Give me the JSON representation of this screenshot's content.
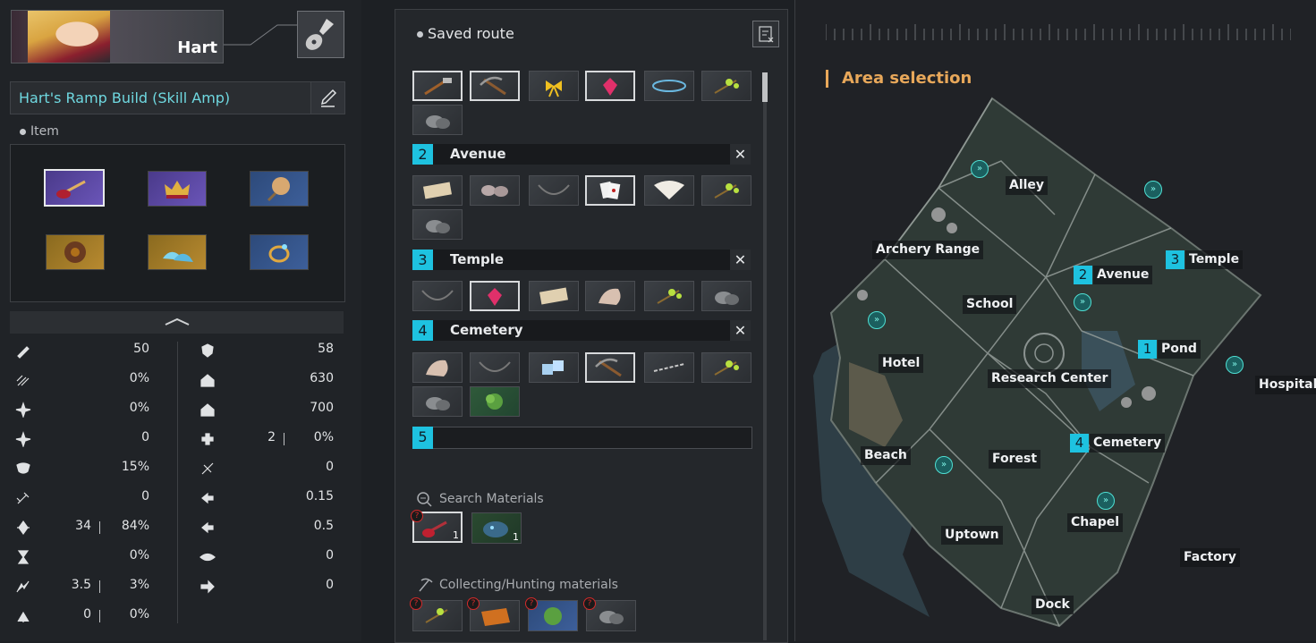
{
  "character": {
    "name": "Hart"
  },
  "build": {
    "name": "Hart's Ramp Build (Skill Amp)"
  },
  "item_section": {
    "label": "Item"
  },
  "stats_left": [
    {
      "icon": "attack-power-icon",
      "a": "",
      "b": "50"
    },
    {
      "icon": "attack-speed-icon",
      "a": "",
      "b": "0%"
    },
    {
      "icon": "critical-chance-icon",
      "a": "",
      "b": "0%"
    },
    {
      "icon": "critical-damage-icon",
      "a": "",
      "b": "0"
    },
    {
      "icon": "life-steal-icon",
      "a": "",
      "b": "15%"
    },
    {
      "icon": "extra-normal-attack-icon",
      "a": "",
      "b": "0"
    },
    {
      "icon": "skill-amp-icon",
      "a": "34",
      "b": "84%"
    },
    {
      "icon": "cooldown-icon",
      "a": "",
      "b": "0%"
    },
    {
      "icon": "sp-regen-icon",
      "a": "3.5",
      "b": "3%"
    },
    {
      "icon": "armor-pen-icon",
      "a": "0",
      "b": "0%"
    }
  ],
  "stats_right": [
    {
      "icon": "defense-icon",
      "a": "",
      "b": "58"
    },
    {
      "icon": "max-hp-icon",
      "a": "",
      "b": "630"
    },
    {
      "icon": "max-sp-icon",
      "a": "",
      "b": "700"
    },
    {
      "icon": "hp-regen-icon",
      "a": "2",
      "b": "0%"
    },
    {
      "icon": "damage-reduction-icon",
      "a": "",
      "b": "0"
    },
    {
      "icon": "movement-speed-icon",
      "a": "",
      "b": "0.15"
    },
    {
      "icon": "out-of-combat-speed-icon",
      "a": "",
      "b": "0.5"
    },
    {
      "icon": "vision-icon",
      "a": "",
      "b": "0"
    },
    {
      "icon": "attack-range-icon",
      "a": "",
      "b": "0"
    }
  ],
  "route": {
    "title": "Saved route",
    "stops": [
      {
        "num": "2",
        "name": "Avenue"
      },
      {
        "num": "3",
        "name": "Temple"
      },
      {
        "num": "4",
        "name": "Cemetery"
      }
    ],
    "empty_num": "5",
    "search_label": "Search Materials",
    "collect_label": "Collecting/Hunting materials",
    "search_counts": [
      "1",
      "1"
    ],
    "badge": "?"
  },
  "map": {
    "title": "Area selection",
    "areas": [
      {
        "name": "Alley"
      },
      {
        "name": "Archery Range"
      },
      {
        "name": "School"
      },
      {
        "name": "Avenue",
        "num": "2"
      },
      {
        "name": "Temple",
        "num": "3"
      },
      {
        "name": "Pond",
        "num": "1"
      },
      {
        "name": "Hotel"
      },
      {
        "name": "Research Center"
      },
      {
        "name": "Hospital"
      },
      {
        "name": "Cemetery",
        "num": "4"
      },
      {
        "name": "Beach"
      },
      {
        "name": "Forest"
      },
      {
        "name": "Chapel"
      },
      {
        "name": "Uptown"
      },
      {
        "name": "Factory"
      },
      {
        "name": "Dock"
      }
    ]
  },
  "colors": {
    "accent": "#1ec2e0",
    "route_title": "#6fd8e0",
    "area_title": "#e8a85a"
  }
}
